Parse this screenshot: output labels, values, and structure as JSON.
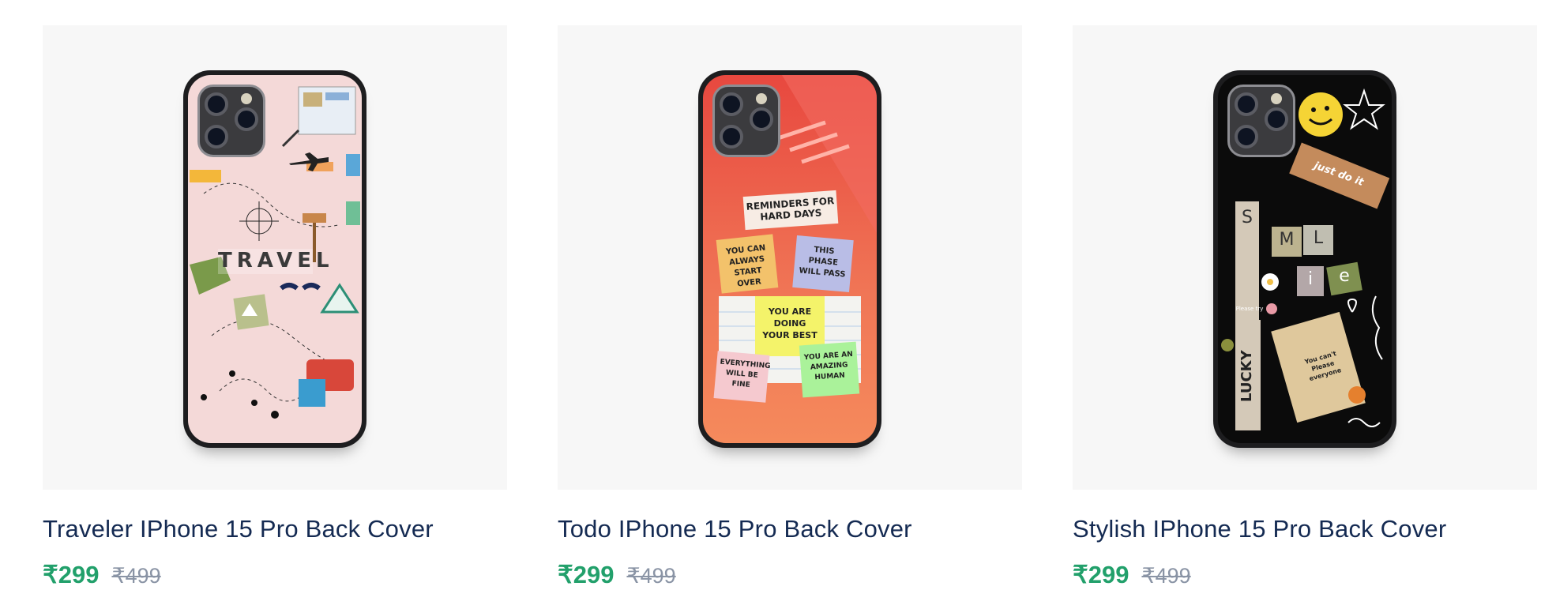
{
  "products": [
    {
      "title": "Traveler IPhone 15 Pro Back Cover",
      "price": "₹299",
      "mrp": "₹499",
      "design": {
        "name": "travel",
        "text": "TRAVEL",
        "background": "#f4d9d8"
      }
    },
    {
      "title": "Todo IPhone 15 Pro Back Cover",
      "price": "₹299",
      "mrp": "₹499",
      "design": {
        "name": "todo",
        "background": "#ef6a52",
        "notes": [
          "REMINDERS FOR HARD DAYS",
          "YOU CAN ALWAYS START OVER",
          "THIS PHASE WILL PASS",
          "YOU ARE DOING YOUR BEST",
          "EVERYTHING WILL BE FINE",
          "YOU ARE AN AMAZING HUMAN"
        ]
      }
    },
    {
      "title": "Stylish IPhone 15 Pro Back Cover",
      "price": "₹299",
      "mrp": "₹499",
      "design": {
        "name": "stylish",
        "background": "#0b0b0b",
        "words": [
          "just do it",
          "S",
          "M",
          "L",
          "i",
          "e",
          "LUCKY",
          "Please try",
          "You can't Please everyone"
        ]
      }
    }
  ]
}
